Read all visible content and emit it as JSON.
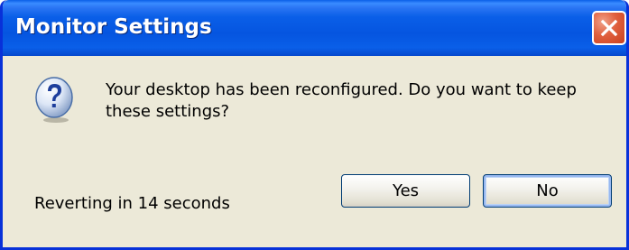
{
  "window": {
    "title": "Monitor Settings",
    "close_icon": "close-icon"
  },
  "dialog": {
    "icon": "question-icon",
    "message": "Your desktop has been reconfigured.  Do you want to keep\nthese settings?",
    "countdown_text": "Reverting in 14 seconds"
  },
  "buttons": {
    "yes_label": "Yes",
    "no_label": "No"
  },
  "colors": {
    "titlebar": "#0a5fe8",
    "window_bg": "#ece9d8",
    "close_button": "#e0603e"
  }
}
